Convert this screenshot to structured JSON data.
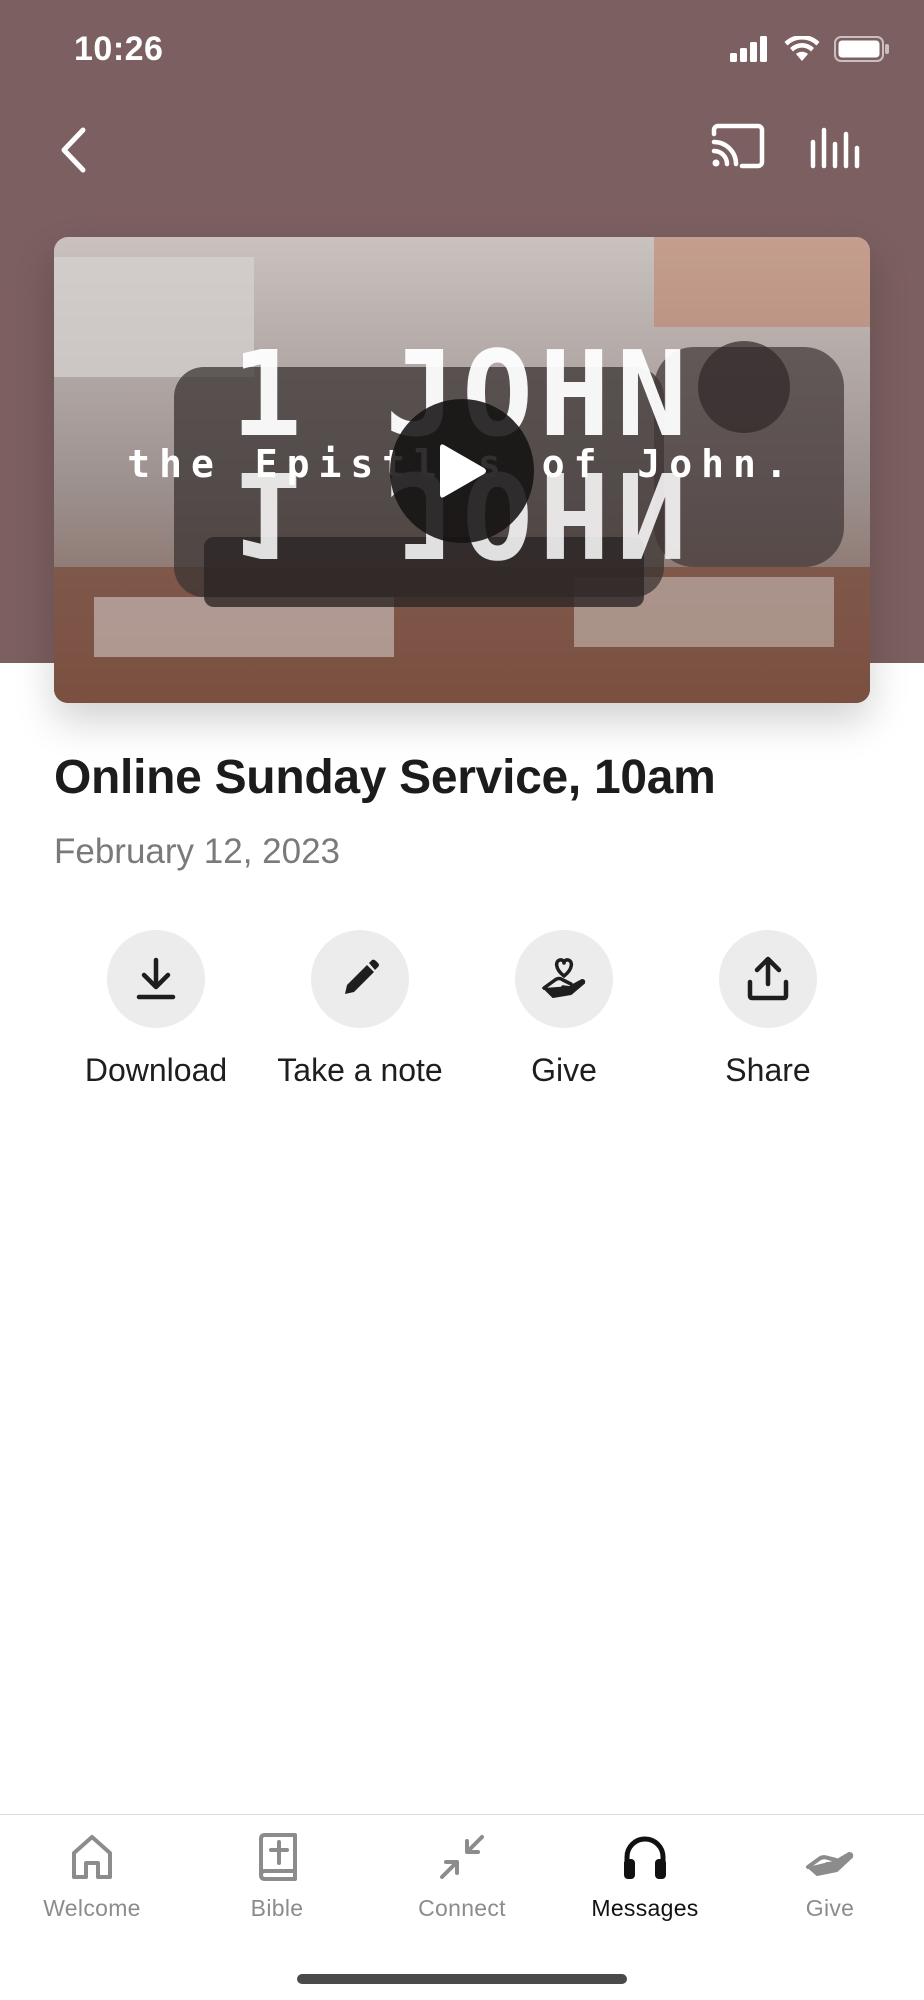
{
  "status_bar": {
    "time": "10:26"
  },
  "header": {
    "background_color": "#7c5f60"
  },
  "video": {
    "artwork_title": "1 JOHN",
    "artwork_subtitle": "the Epistles of John."
  },
  "sermon": {
    "title": "Online Sunday Service, 10am",
    "date": "February 12, 2023"
  },
  "actions": [
    {
      "label": "Download",
      "icon": "download-icon"
    },
    {
      "label": "Take a note",
      "icon": "pencil-icon"
    },
    {
      "label": "Give",
      "icon": "hand-heart-icon"
    },
    {
      "label": "Share",
      "icon": "share-icon"
    }
  ],
  "tabs": [
    {
      "label": "Welcome",
      "icon": "home-icon",
      "active": false
    },
    {
      "label": "Bible",
      "icon": "bible-icon",
      "active": false
    },
    {
      "label": "Connect",
      "icon": "connect-icon",
      "active": false
    },
    {
      "label": "Messages",
      "icon": "headphones-icon",
      "active": true
    },
    {
      "label": "Give",
      "icon": "give-hand-icon",
      "active": false
    }
  ],
  "colors": {
    "accent": "#7c5f60",
    "active_tab": "#111111",
    "inactive_tab": "#8c8c8c"
  }
}
